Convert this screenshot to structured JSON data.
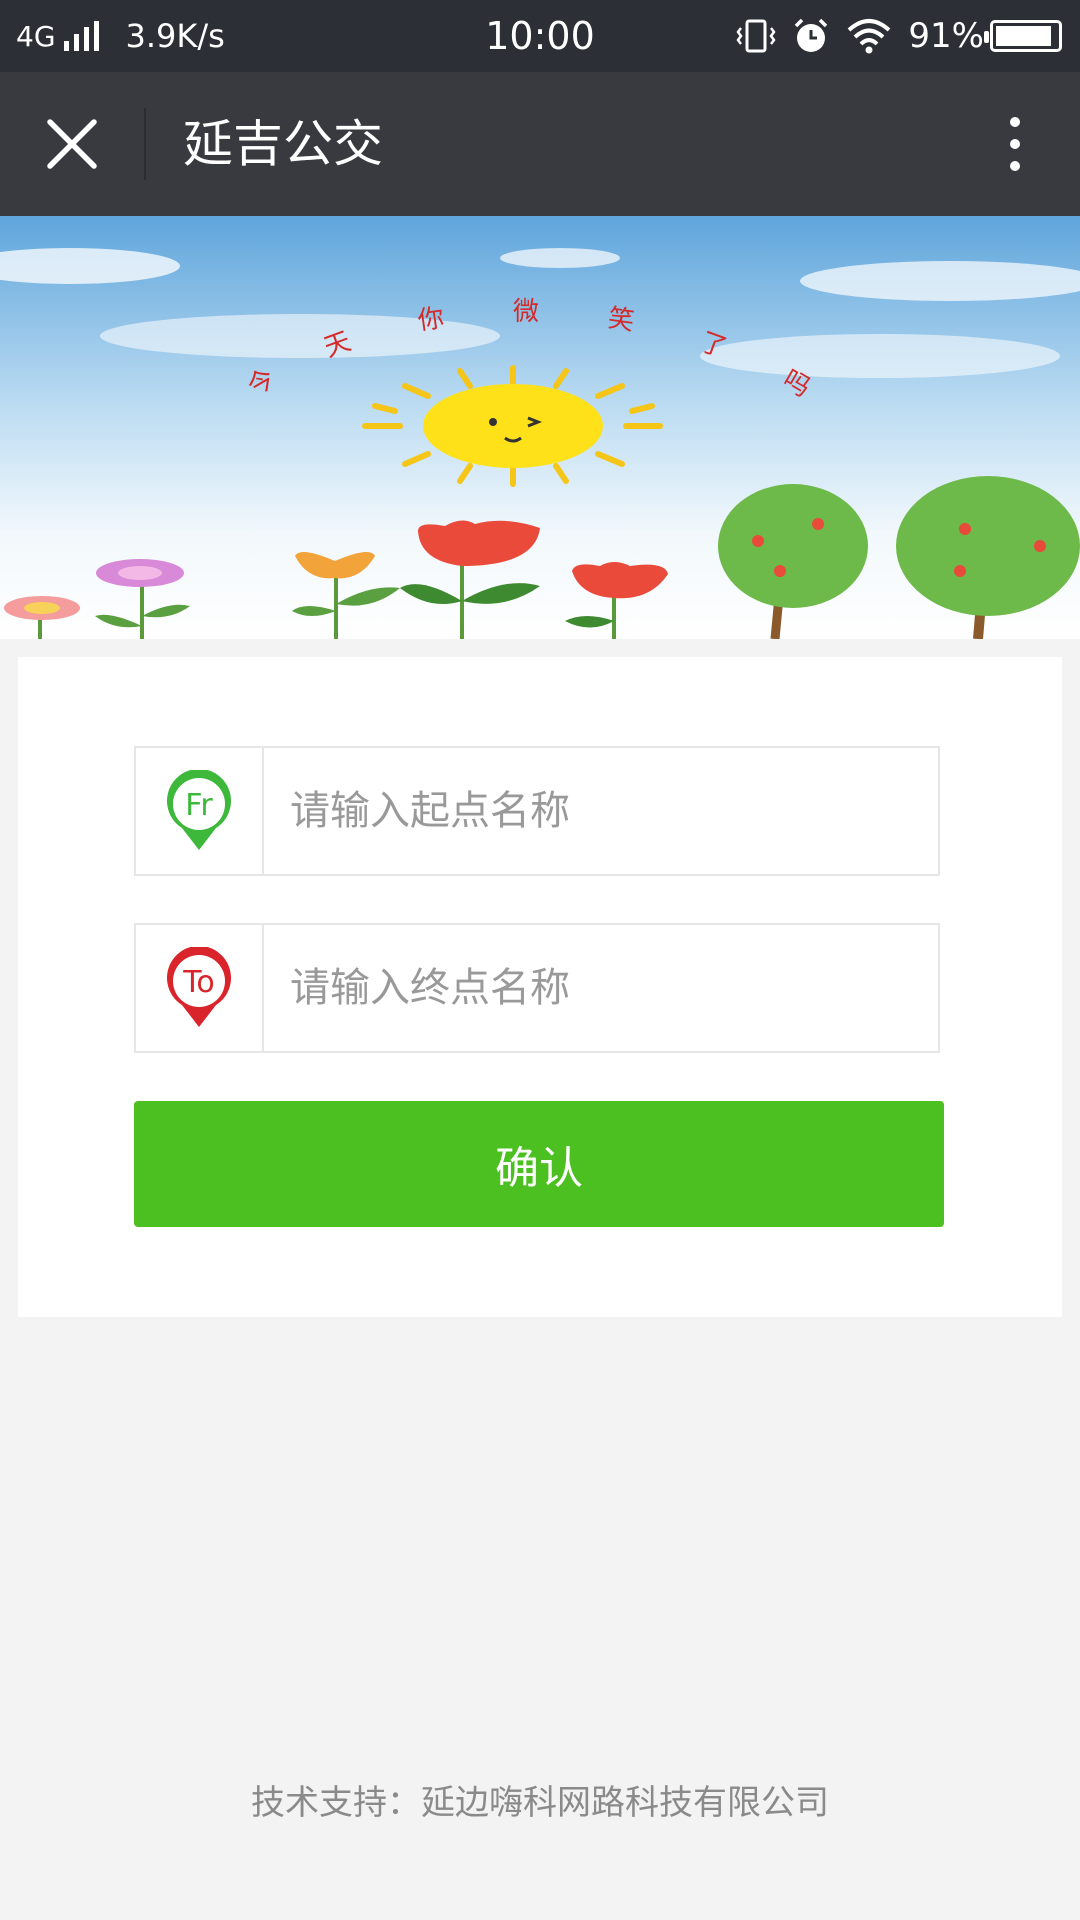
{
  "status_bar": {
    "network": "4G",
    "speed": "3.9K/s",
    "time": "10:00",
    "battery": "91%",
    "icons": [
      "signal-icon",
      "vibrate-icon",
      "alarm-icon",
      "wifi-icon",
      "battery-icon"
    ]
  },
  "header": {
    "title": "延吉公交",
    "close_icon": "close-icon",
    "more_icon": "more-vertical-icon"
  },
  "banner": {
    "text_chars": [
      "今",
      "天",
      "你",
      "微",
      "笑",
      "了",
      "吗"
    ]
  },
  "form": {
    "from": {
      "badge": "Fr",
      "placeholder": "请输入起点名称",
      "value": "",
      "color": "#3eb83a"
    },
    "to": {
      "badge": "To",
      "placeholder": "请输入终点名称",
      "value": "",
      "color": "#d9242b"
    },
    "confirm_label": "确认",
    "confirm_color": "#4bc020"
  },
  "footer": {
    "text": "技术支持：延边嗨科网路科技有限公司"
  }
}
